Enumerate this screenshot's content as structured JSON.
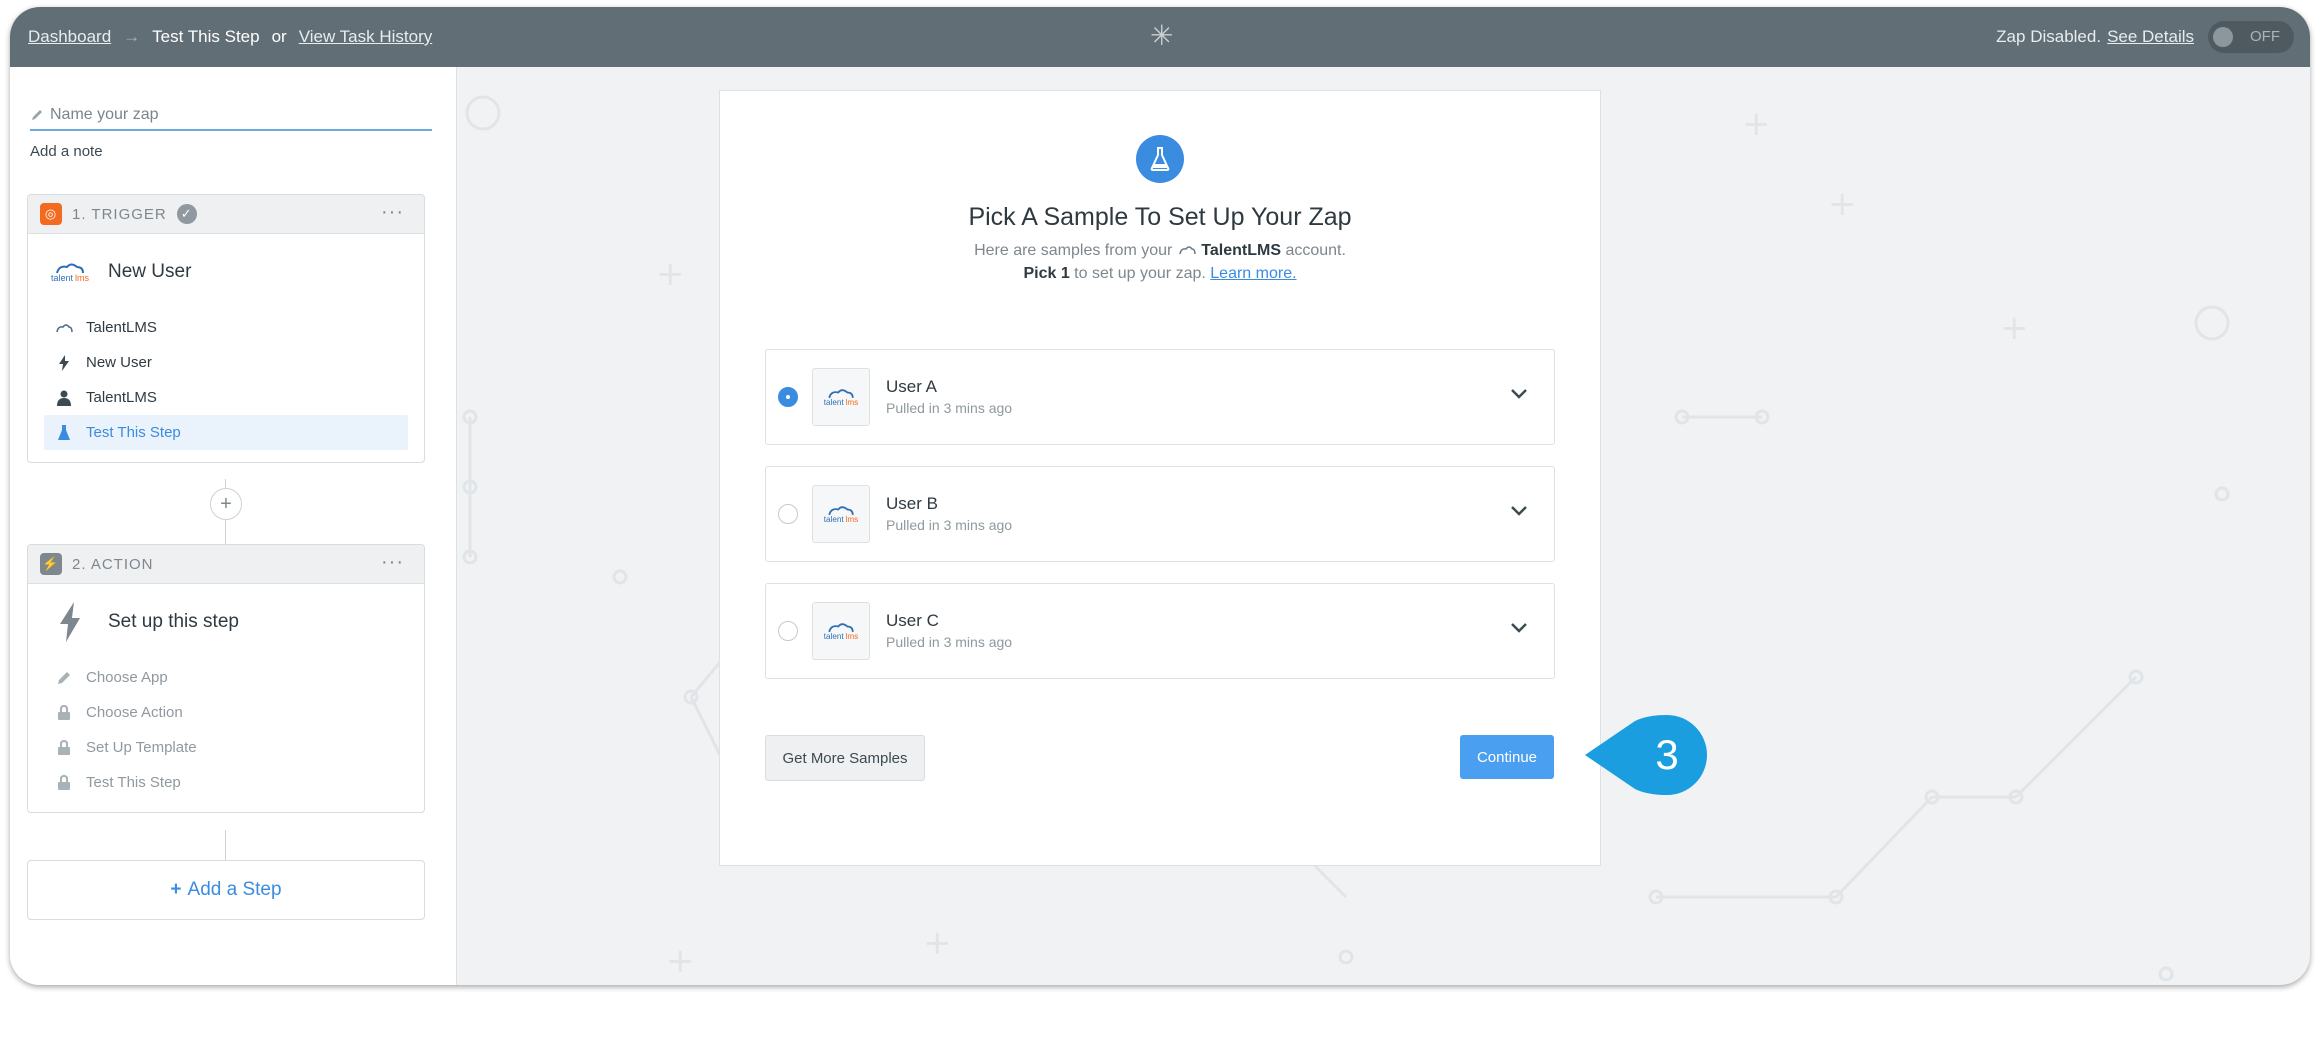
{
  "topbar": {
    "dashboard_link": "Dashboard",
    "arrow": "→",
    "current": "Test This Step",
    "or": "or",
    "task_history_link": "View Task History",
    "status_text": "Zap Disabled.",
    "see_details_link": "See Details",
    "toggle_label": "OFF"
  },
  "sidebar": {
    "zap_name_placeholder": "Name your zap",
    "add_note": "Add a note",
    "trigger": {
      "header": "1. TRIGGER",
      "title": "New User",
      "steps": [
        {
          "label": "TalentLMS",
          "icon": "talentlms-icon"
        },
        {
          "label": "New User",
          "icon": "bolt-icon"
        },
        {
          "label": "TalentLMS",
          "icon": "person-icon"
        },
        {
          "label": "Test This Step",
          "icon": "flask-icon"
        }
      ]
    },
    "action": {
      "header": "2. ACTION",
      "title": "Set up this step",
      "steps": [
        {
          "label": "Choose App",
          "icon": "pencil-icon"
        },
        {
          "label": "Choose Action",
          "icon": "lock-icon"
        },
        {
          "label": "Set Up Template",
          "icon": "lock-icon"
        },
        {
          "label": "Test This Step",
          "icon": "lock-icon"
        }
      ]
    },
    "add_step": "Add a Step"
  },
  "main": {
    "title": "Pick A Sample To Set Up Your Zap",
    "subtitle_pre": "Here are samples from your",
    "subtitle_app": "TalentLMS",
    "subtitle_post": "account.",
    "pick_bold": "Pick 1",
    "pick_rest": "to set up your zap.",
    "learn_more": "Learn more.",
    "samples": [
      {
        "name": "User A",
        "pulled": "Pulled in 3 mins ago",
        "selected": true
      },
      {
        "name": "User B",
        "pulled": "Pulled in 3 mins ago",
        "selected": false
      },
      {
        "name": "User C",
        "pulled": "Pulled in 3 mins ago",
        "selected": false
      }
    ],
    "get_more_samples": "Get More Samples",
    "continue": "Continue"
  },
  "callout": {
    "number": "3"
  },
  "colors": {
    "accent": "#3a8ce0",
    "topbar": "#626e75",
    "trigger_badge": "#f26b21",
    "action_badge": "#7d878d",
    "callout": "#1a9ee0"
  }
}
